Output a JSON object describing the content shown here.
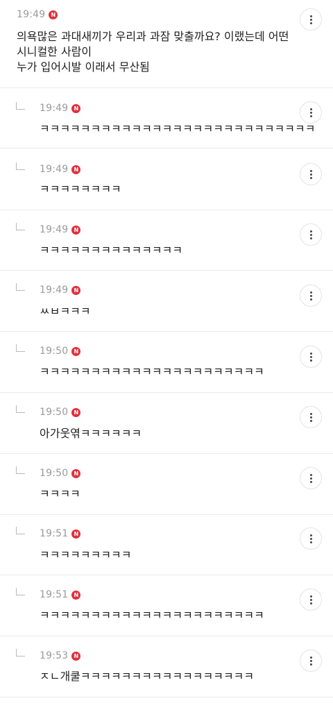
{
  "main_comment": {
    "time": "19:49",
    "badge": "N",
    "text": "의욕많은 과대새끼가 우리과 과잠 맞출까요? 이랬는데 어떤\n시니컬한 사람이\n누가 입어시발 이래서 무산됨"
  },
  "replies": [
    {
      "time": "19:49",
      "badge": "N",
      "text": "ㅋㅋㅋㅋㅋㅋㅋㅋㅋㅋㅋㅋㅋㅋㅋㅋㅋㅋㅋㅋㅋㅋㅋㅋㅋㅋㅋ"
    },
    {
      "time": "19:49",
      "badge": "N",
      "text": "ㅋㅋㅋㅋㅋㅋㅋㅋ"
    },
    {
      "time": "19:49",
      "badge": "N",
      "text": "ㅋㅋㅋㅋㅋㅋㅋㅋㅋㅋㅋㅋㅋㅋ"
    },
    {
      "time": "19:49",
      "badge": "N",
      "text": "ㅆㅂㅋㅋㅋ"
    },
    {
      "time": "19:50",
      "badge": "N",
      "text": "ㅋㅋㅋㅋㅋㅋㅋㅋㅋㅋㅋㅋㅋㅋㅋㅋㅋㅋㅋㅋㅋㅋ"
    },
    {
      "time": "19:50",
      "badge": "N",
      "text": "아가웃엮ㅋㅋㅋㅋㅋㅋ"
    },
    {
      "time": "19:50",
      "badge": "N",
      "text": "ㅋㅋㅋㅋ"
    },
    {
      "time": "19:51",
      "badge": "N",
      "text": "ㅋㅋㅋㅋㅋㅋㅋㅋㅋ"
    },
    {
      "time": "19:51",
      "badge": "N",
      "text": "ㅋㅋㅋㅋㅋㅋㅋㅋㅋㅋㅋㅋㅋㅋㅋㅋㅋㅋㅋㅋㅋㅋ"
    },
    {
      "time": "19:53",
      "badge": "N",
      "text": "ㅈㄴ개쿨ㅋㅋㅋㅋㅋㅋㅋㅋㅋㅋㅋㅋㅋㅋㅋㅋㅋ"
    }
  ],
  "colors": {
    "badge": "#e1303c",
    "time": "#9a9a9a",
    "divider": "#ebebeb"
  },
  "icons": {
    "reply": "reply-arrow-icon",
    "more": "more-vertical-icon"
  }
}
